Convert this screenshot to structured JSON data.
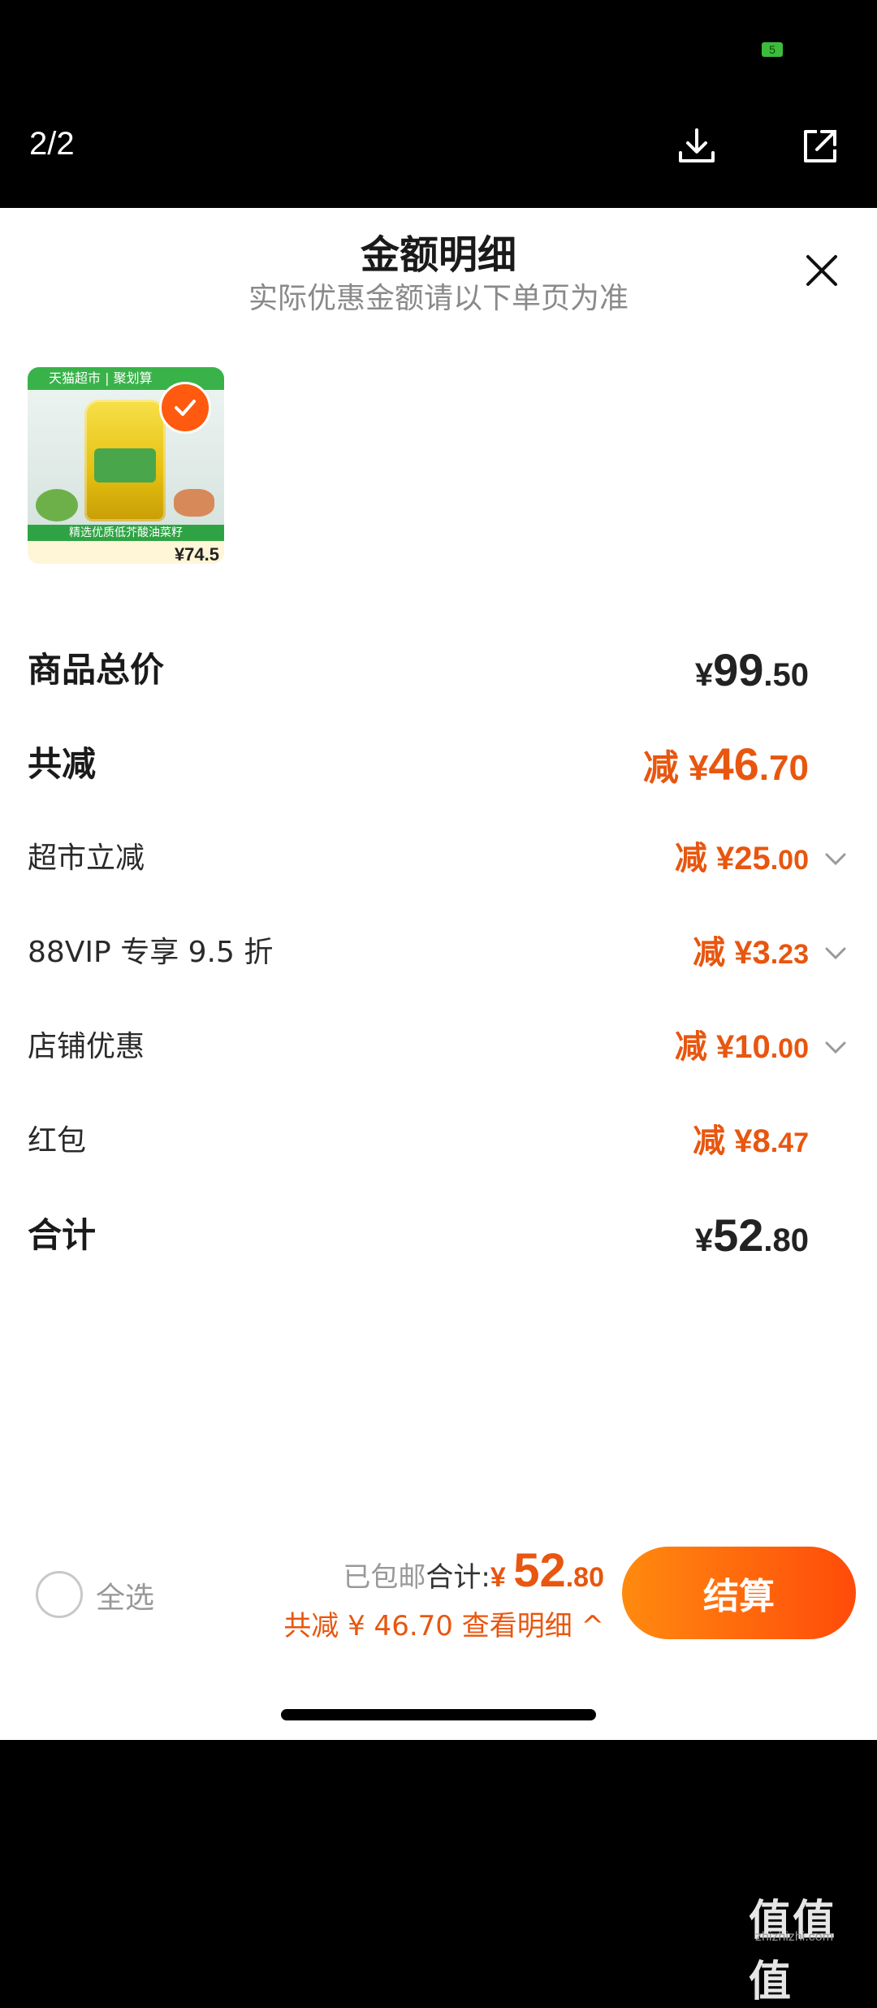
{
  "status_bar": {
    "battery": "5"
  },
  "viewer": {
    "pager": "2/2",
    "download_icon": "download-icon",
    "share_icon": "share-icon"
  },
  "sheet": {
    "title": "金额明细",
    "subtitle": "实际优惠金额请以下单页为准",
    "close_icon": "close-icon"
  },
  "product": {
    "badge_text": "天猫超市 | 聚划算",
    "strip_text": "精选优质低芥酸油菜籽",
    "price": "¥74.5"
  },
  "rows": {
    "total": {
      "label": "商品总价",
      "cur": "¥",
      "int": "99",
      "dec": ".50"
    },
    "reduce": {
      "label": "共减",
      "prefix": "减 ",
      "cur": "¥",
      "int": "46",
      "dec": ".70"
    },
    "items": [
      {
        "label": "超市立减",
        "prefix": "减 ",
        "cur": "¥",
        "int": "25",
        "dec": ".00",
        "expandable": true
      },
      {
        "label": "88VIP 专享 9.5 折",
        "prefix": "减 ",
        "cur": "¥",
        "int": "3",
        "dec": ".23",
        "expandable": true
      },
      {
        "label": "店铺优惠",
        "prefix": "减 ",
        "cur": "¥",
        "int": "10",
        "dec": ".00",
        "expandable": true
      },
      {
        "label": "红包",
        "prefix": "减 ",
        "cur": "¥",
        "int": "8",
        "dec": ".47",
        "expandable": false
      }
    ],
    "sum": {
      "label": "合计",
      "cur": "¥",
      "int": "52",
      "dec": ".80"
    }
  },
  "footer": {
    "select_all": "全选",
    "shipping": "已包邮",
    "total_label": "合计:",
    "total_cur": "¥ ",
    "total_int": "52",
    "total_dec": ".80",
    "reduce_text": "共减 ¥ 46.70  查看明细 ^",
    "checkout": "结算"
  },
  "watermark": {
    "text": "值值值",
    "site": "zhizhizhi.com"
  },
  "colors": {
    "accent": "#e8560f",
    "checkout_start": "#ff8a0f",
    "checkout_end": "#ff4b0a"
  }
}
